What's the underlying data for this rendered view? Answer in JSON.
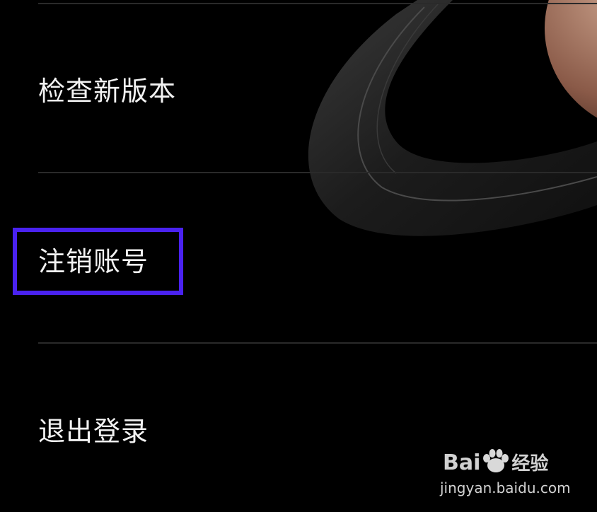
{
  "menu": {
    "items": [
      {
        "label": "检查新版本"
      },
      {
        "label": "注销账号"
      },
      {
        "label": "退出登录"
      }
    ]
  },
  "highlight_color": "#4a22f0",
  "watermark": {
    "brand_prefix": "Bai",
    "brand_suffix": "经验",
    "url": "jingyan.baidu.com"
  }
}
